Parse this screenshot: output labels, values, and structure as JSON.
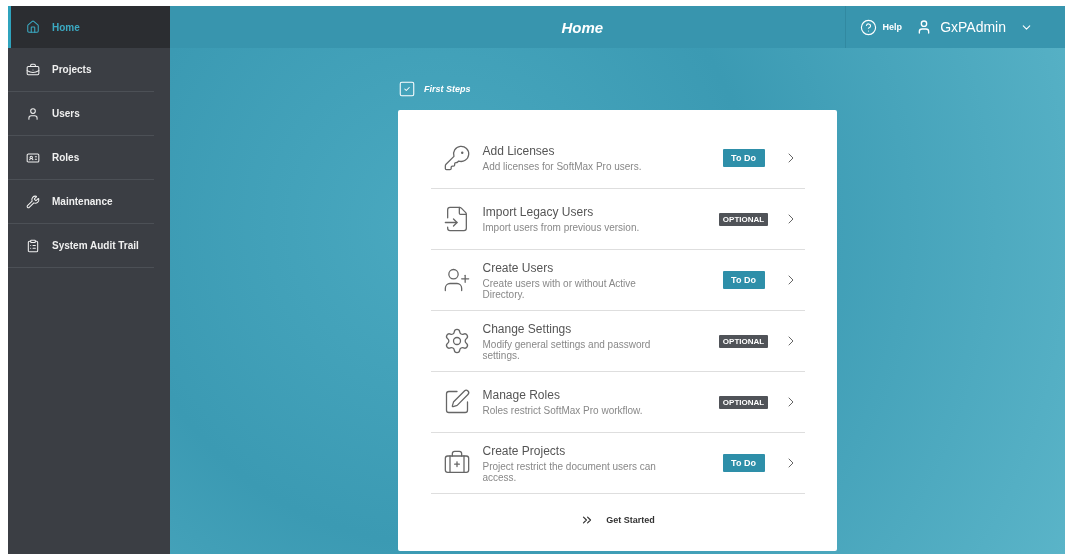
{
  "sidebar": {
    "items": [
      {
        "label": "Home",
        "selected": true
      },
      {
        "label": "Projects",
        "selected": false
      },
      {
        "label": "Users",
        "selected": false
      },
      {
        "label": "Roles",
        "selected": false
      },
      {
        "label": "Maintenance",
        "selected": false
      },
      {
        "label": "System Audit Trail",
        "selected": false
      }
    ]
  },
  "header": {
    "title": "Home",
    "help": "Help",
    "user": "GxPAdmin"
  },
  "first_steps": {
    "title": "First Steps",
    "steps": [
      {
        "title": "Add Licenses",
        "description": "Add licenses for SoftMax Pro users.",
        "kind": "todo",
        "badge": "To Do"
      },
      {
        "title": "Import Legacy Users",
        "description": "Import users from previous version.",
        "kind": "optional",
        "badge": "OPTIONAL"
      },
      {
        "title": "Create Users",
        "description": "Create users with or without Active Directory.",
        "kind": "todo",
        "badge": "To Do"
      },
      {
        "title": "Change Settings",
        "description": "Modify general settings and password settings.",
        "kind": "optional",
        "badge": "OPTIONAL"
      },
      {
        "title": "Manage Roles",
        "description": "Roles restrict SoftMax Pro workflow.",
        "kind": "optional",
        "badge": "OPTIONAL"
      },
      {
        "title": "Create Projects",
        "description": "Project restrict the document users can access.",
        "kind": "todo",
        "badge": "To Do"
      }
    ],
    "action": "Get Started"
  }
}
